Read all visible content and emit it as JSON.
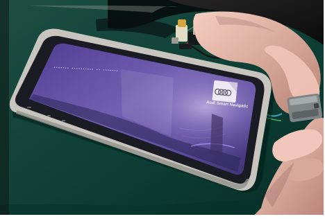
{
  "screen": {
    "status_text": "••••••• •••••••••• •• •••••••",
    "title": "Audi Smart Navigation",
    "logo": "four-rings-logo"
  },
  "colors": {
    "screen_purple": "#5d4f9f",
    "screen_highlight": "#bca5dc",
    "bezel_dark": "#1b1b24",
    "table_green": "#0f4c3f"
  }
}
